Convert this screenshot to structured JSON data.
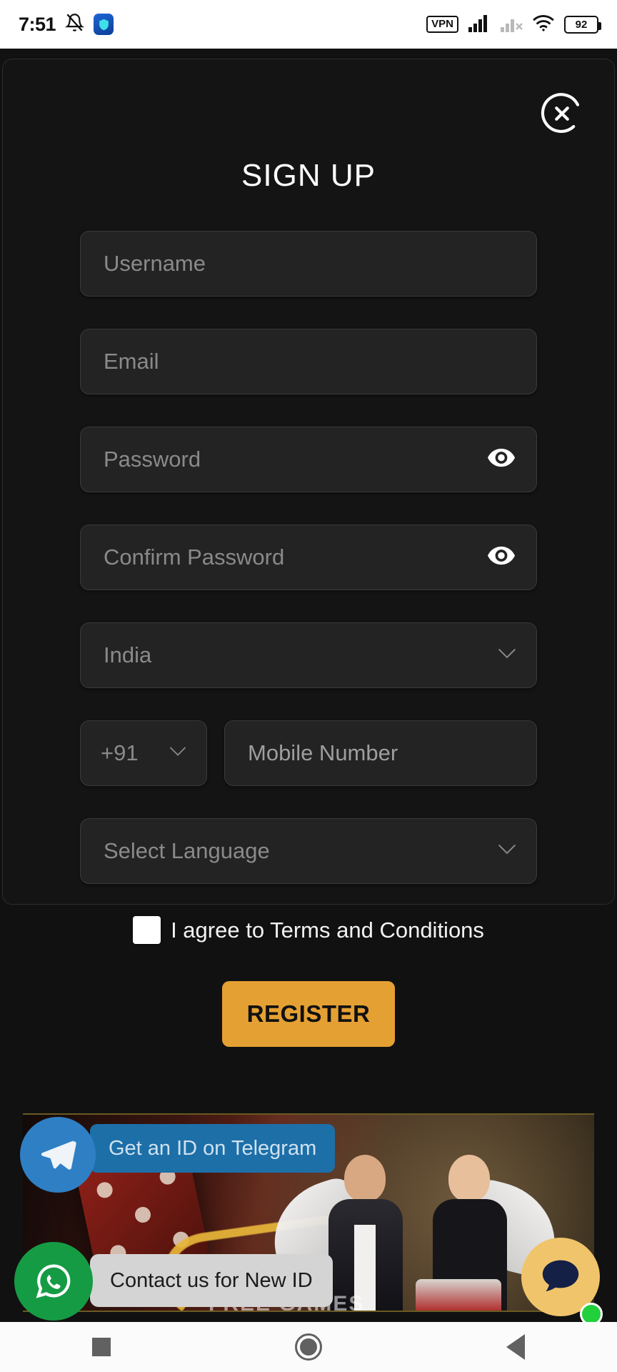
{
  "status_bar": {
    "time": "7:51",
    "notification_icon": "bell-muted-icon",
    "vpn_app_icon": "shield-vpn-app-icon",
    "vpn_badge": "VPN",
    "signal_primary_icon": "signal-bars-full-icon",
    "signal_secondary_icon": "signal-bars-no-service-icon",
    "wifi_icon": "wifi-icon",
    "battery_level": "92"
  },
  "modal": {
    "title": "SIGN UP",
    "close_icon": "close-circle-icon",
    "fields": {
      "username": {
        "placeholder": "Username",
        "value": ""
      },
      "email": {
        "placeholder": "Email",
        "value": ""
      },
      "password": {
        "placeholder": "Password",
        "value": "",
        "toggle_icon": "eye-icon"
      },
      "confirm_password": {
        "placeholder": "Confirm Password",
        "value": "",
        "toggle_icon": "eye-icon"
      },
      "country": {
        "value": "India",
        "chevron_icon": "chevron-down-icon"
      },
      "country_code": {
        "value": "+91",
        "chevron_icon": "chevron-down-icon"
      },
      "mobile": {
        "placeholder": "Mobile Number",
        "value": ""
      },
      "language": {
        "value": "Select Language",
        "chevron_icon": "chevron-down-icon"
      }
    },
    "terms": {
      "label": "I agree to Terms and Conditions",
      "checked": false
    },
    "register_label": "REGISTER",
    "accent_color": "#e5a033"
  },
  "background": {
    "telegram": {
      "label": "Get an ID on Telegram",
      "icon": "telegram-icon",
      "color": "#1d6fa8"
    },
    "whatsapp": {
      "label": "Contact us for New ID",
      "icon": "whatsapp-icon",
      "color": "#169b45"
    },
    "chat_widget": {
      "icon": "chat-bubble-icon",
      "color": "#f0c46a",
      "status_icon": "online-dot-icon"
    },
    "banner_text": "FREE GAMES"
  },
  "navbar": {
    "recents_icon": "square-recents-icon",
    "home_icon": "circle-home-icon",
    "back_icon": "triangle-back-icon"
  }
}
